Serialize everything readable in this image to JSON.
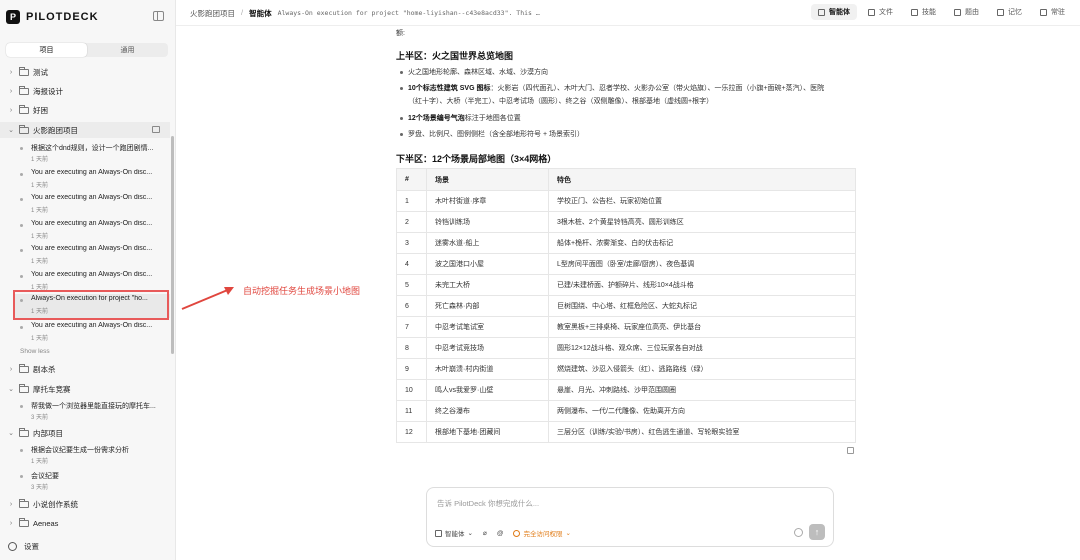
{
  "sidebar": {
    "logo_text": "PILOTDECK",
    "logo_mark": "P",
    "segments": [
      "项目",
      "通用"
    ],
    "folders": {
      "test": "测试",
      "poster": "海报设计",
      "good": "好困",
      "huoying": "火影跑团项目",
      "script": "剧本杀",
      "moto": "摩托车竞赛",
      "internal": "内部项目",
      "novel": "小说创作系统",
      "aeneas": "Aeneas"
    },
    "huoying_convs": [
      {
        "title": "根据这个dnd规则，设计一个跑团剧情...",
        "time": "1 天前"
      },
      {
        "title": "You are executing an Always-On disc...",
        "time": "1 天前"
      },
      {
        "title": "You are executing an Always-On disc...",
        "time": "1 天前"
      },
      {
        "title": "You are executing an Always-On disc...",
        "time": "1 天前"
      },
      {
        "title": "You are executing an Always-On disc...",
        "time": "1 天前"
      },
      {
        "title": "You are executing an Always-On disc...",
        "time": "1 天前"
      },
      {
        "title": "Always-On execution for project \"ho...",
        "time": "1 天前"
      },
      {
        "title": "You are executing an Always-On disc...",
        "time": "1 天前"
      }
    ],
    "show_less": "Show less",
    "moto_convs": [
      {
        "title": "帮我做一个浏览器里能直接玩的摩托车...",
        "time": "3 天前"
      }
    ],
    "internal_convs": [
      {
        "title": "根据会议纪要生成一份需求分析",
        "time": "1 天前"
      },
      {
        "title": "会议纪要",
        "time": "3 天前"
      }
    ],
    "settings_label": "设置"
  },
  "topbar": {
    "crumb_project": "火影跑团项目",
    "crumb_sep": "/",
    "crumb_current": "智能体",
    "crumb_session": "Always-On execution for project \"home-liyishan--c43e8acd33\". This …",
    "tabs": [
      "智能体",
      "文件",
      "技能",
      "题由",
      "记忆",
      "常驻"
    ]
  },
  "content": {
    "pre_text": "额:",
    "heading_top": "上半区：火之国世界总览地图",
    "bullets": [
      {
        "bold": "",
        "text": "火之国地形轮廓、森林区域、水域、沙漠方向"
      },
      {
        "bold": "10个标志性建筑 SVG 图标",
        "text": "：火影岩（四代面孔）、木叶大门、忍者学校、火影办公室（带火焰旗）、一乐拉面（小旗+面碗+蒸汽）、医院（红十字）、大桥（半完工）、中忍考试场（圆形）、终之谷（双侧雕像）、根部基地（虚线圆+根字）"
      },
      {
        "bold": "12个场景编号气泡",
        "text": "标注于地图各位置"
      },
      {
        "bold": "",
        "text": "罗盘、比例尺、图例侧栏（含全部地形符号 + 场景索引）"
      }
    ],
    "heading_bottom": "下半区：12个场景局部地图（3×4网格）",
    "table_headers": [
      "#",
      "场景",
      "特色"
    ],
    "table_rows": [
      [
        "1",
        "木叶村街道·序章",
        "学校正门、公告栏、玩家初始位置"
      ],
      [
        "2",
        "铃铛训练场",
        "3根木桩、2个黄星铃铛高亮、圆形训练区"
      ],
      [
        "3",
        "迷雾水道·船上",
        "船体+桅杆、浓雾渐变、白的伏击标记"
      ],
      [
        "4",
        "波之国港口小屋",
        "L型房间平面图（卧室/走廊/厨房）、夜色基调"
      ],
      [
        "5",
        "未完工大桥",
        "已建/未建桥面、护额碎片、线形10×4战斗格"
      ],
      [
        "6",
        "死亡森林·内部",
        "巨树围绕、中心塔、红框危险区、大蛇丸标记"
      ],
      [
        "7",
        "中忍考试笔试室",
        "教室黑板+三排桌椅、玩家座位高亮、伊比基台"
      ],
      [
        "8",
        "中忍考试竞技场",
        "圆形12×12战斗格、观众席、三位玩家各自对战"
      ],
      [
        "9",
        "木叶崩溃·村内街道",
        "燃烧建筑、沙忍入侵箭头（红）、逃路路线（绿）"
      ],
      [
        "10",
        "鸣人vs我爱罗·山壁",
        "悬崖、月光、冲刺路线、沙甲范围圆圈"
      ],
      [
        "11",
        "终之谷瀑布",
        "两侧瀑布、一代/二代雕像、佐助离开方向"
      ],
      [
        "12",
        "根部地下基地·团藏间",
        "三层分区（训练/实验/书房）、红色逃生通道、写轮眼实验室"
      ]
    ]
  },
  "annotation": {
    "text": "自动挖掘任务生成场景小地图",
    "color": "#e0463e"
  },
  "composer": {
    "placeholder": "告诉 PilotDeck 你想完成什么...",
    "mode_label": "智能体",
    "permission_label": "完全访问权限",
    "send_icon": "↑"
  }
}
